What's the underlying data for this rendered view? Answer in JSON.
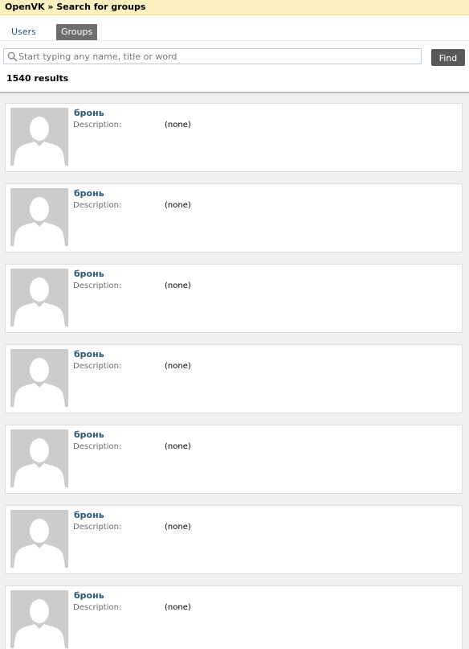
{
  "header": {
    "breadcrumb": "OpenVK » Search for groups"
  },
  "tabs": [
    {
      "label": "Users",
      "active": false
    },
    {
      "label": "Groups",
      "active": true
    }
  ],
  "search": {
    "placeholder": "Start typing any name, title or word",
    "value": "",
    "button_label": "Find"
  },
  "results_count": "1540 results",
  "colors": {
    "topbar_bg": "#fcf0c0",
    "link": "#2b587a",
    "active_tab": "#6e6e6e",
    "avatar_placeholder": "#cccccc"
  },
  "results": [
    {
      "name": "бронь",
      "description_label": "Description:",
      "description": "(none)",
      "avatar": "default-avatar-icon"
    },
    {
      "name": "бронь",
      "description_label": "Description:",
      "description": "(none)",
      "avatar": "default-avatar-icon"
    },
    {
      "name": "бронь",
      "description_label": "Description:",
      "description": "(none)",
      "avatar": "default-avatar-icon"
    },
    {
      "name": "бронь",
      "description_label": "Description:",
      "description": "(none)",
      "avatar": "default-avatar-icon"
    },
    {
      "name": "бронь",
      "description_label": "Description:",
      "description": "(none)",
      "avatar": "default-avatar-icon"
    },
    {
      "name": "бронь",
      "description_label": "Description:",
      "description": "(none)",
      "avatar": "default-avatar-icon"
    },
    {
      "name": "бронь",
      "description_label": "Description:",
      "description": "(none)",
      "avatar": "default-avatar-icon"
    }
  ]
}
